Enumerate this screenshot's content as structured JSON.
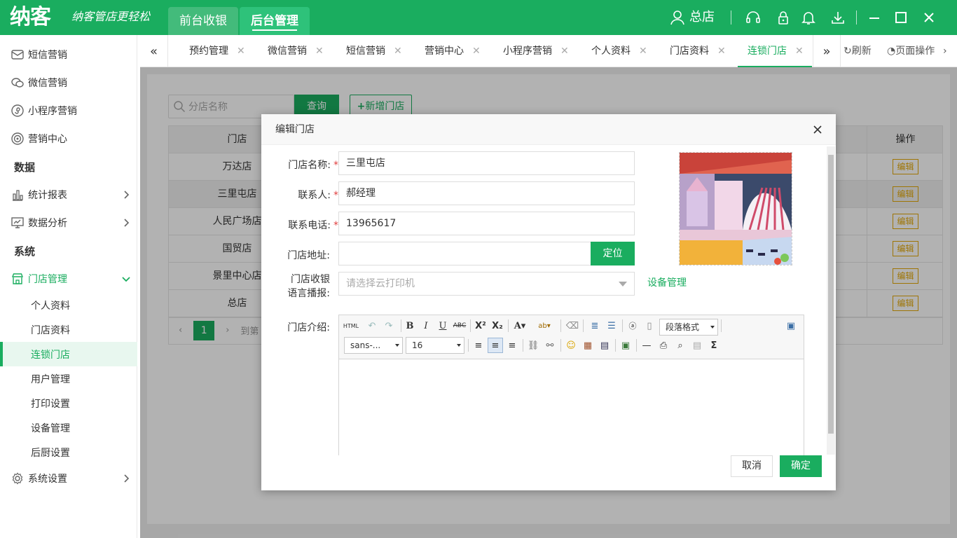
{
  "header": {
    "logo": "纳客",
    "slogan": "纳客管店更轻松",
    "tabs": [
      {
        "label": "前台收银"
      },
      {
        "label": "后台管理"
      }
    ],
    "store": "总店",
    "colors": {
      "brand": "#1aad5f"
    }
  },
  "sidebar": {
    "items": [
      {
        "label": "短信营销",
        "icon": "mail-icon"
      },
      {
        "label": "微信营销",
        "icon": "wechat-icon"
      },
      {
        "label": "小程序营销",
        "icon": "miniprogram-icon"
      },
      {
        "label": "营销中心",
        "icon": "target-icon"
      }
    ],
    "group_data": "数据",
    "data_items": [
      {
        "label": "统计报表",
        "icon": "bar-chart-icon"
      },
      {
        "label": "数据分析",
        "icon": "analysis-icon"
      }
    ],
    "group_system": "系统",
    "store_mgmt": "门店管理",
    "store_sub": [
      {
        "label": "个人资料"
      },
      {
        "label": "门店资料"
      },
      {
        "label": "连锁门店"
      },
      {
        "label": "用户管理"
      },
      {
        "label": "打印设置"
      },
      {
        "label": "设备管理"
      },
      {
        "label": "后厨设置"
      }
    ],
    "sys_settings": "系统设置"
  },
  "tabbar": {
    "tabs": [
      {
        "label": "预约管理"
      },
      {
        "label": "微信营销"
      },
      {
        "label": "短信营销"
      },
      {
        "label": "营销中心"
      },
      {
        "label": "小程序营销"
      },
      {
        "label": "个人资料"
      },
      {
        "label": "门店资料"
      },
      {
        "label": "连锁门店"
      }
    ],
    "refresh": "刷新",
    "page_ops": "页面操作"
  },
  "list": {
    "search_placeholder": "分店名称",
    "query_label": "查询",
    "add_label": "新增门店",
    "col_name": "门店",
    "col_op": "操作",
    "rows": [
      {
        "name": "万达店",
        "op": "编辑"
      },
      {
        "name": "三里屯店",
        "op": "编辑"
      },
      {
        "name": "人民广场店",
        "op": "编辑"
      },
      {
        "name": "国贸店",
        "op": "编辑"
      },
      {
        "name": "景里中心店",
        "op": "编辑"
      },
      {
        "name": "总店",
        "op": "编辑"
      }
    ],
    "pager": {
      "page": "1",
      "goto": "到第"
    }
  },
  "modal": {
    "title": "编辑门店",
    "fields": {
      "name_label": "门店名称:",
      "name_value": "三里屯店",
      "contact_label": "联系人:",
      "contact_value": "郝经理",
      "phone_label": "联系电话:",
      "phone_value": "13965617",
      "address_label": "门店地址:",
      "address_value": "",
      "locate_label": "定位",
      "voice_label_1": "门店收银",
      "voice_label_2": "语言播报:",
      "voice_placeholder": "请选择云打印机",
      "device_link": "设备管理",
      "intro_label": "门店介绍:"
    },
    "editor": {
      "font_family": "sans-...",
      "font_size": "16",
      "paragraph": "段落格式",
      "html_btn": "HTML"
    },
    "cancel": "取消",
    "ok": "确定"
  }
}
